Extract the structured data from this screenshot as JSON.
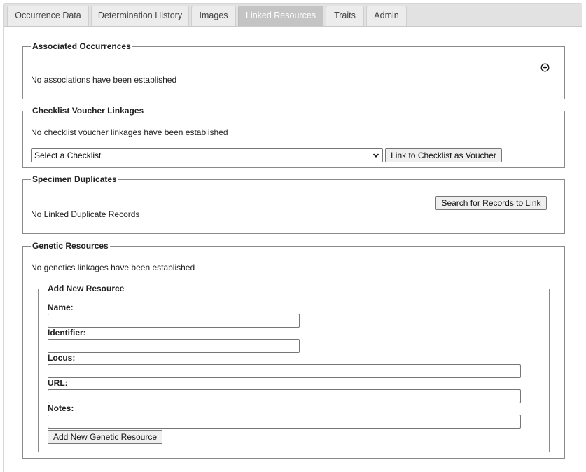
{
  "tabs": [
    {
      "label": "Occurrence Data"
    },
    {
      "label": "Determination History"
    },
    {
      "label": "Images"
    },
    {
      "label": "Linked Resources"
    },
    {
      "label": "Traits"
    },
    {
      "label": "Admin"
    }
  ],
  "active_tab": "Linked Resources",
  "associated_occurrences": {
    "legend": "Associated Occurrences",
    "message": "No associations have been established",
    "add_icon": "plus-circle-icon"
  },
  "checklist_voucher": {
    "legend": "Checklist Voucher Linkages",
    "message": "No checklist voucher linkages have been established",
    "select_value": "Select a Checklist",
    "link_button": "Link to Checklist as Voucher"
  },
  "specimen_duplicates": {
    "legend": "Specimen Duplicates",
    "search_button": "Search for Records to Link",
    "message": "No Linked Duplicate Records"
  },
  "genetic_resources": {
    "legend": "Genetic Resources",
    "message": "No genetics linkages have been established",
    "add_new": {
      "legend": "Add New Resource",
      "name_label": "Name:",
      "name_value": "",
      "identifier_label": "Identifier:",
      "identifier_value": "",
      "locus_label": "Locus:",
      "locus_value": "",
      "url_label": "URL:",
      "url_value": "",
      "notes_label": "Notes:",
      "notes_value": "",
      "submit_button": "Add New Genetic Resource"
    }
  }
}
